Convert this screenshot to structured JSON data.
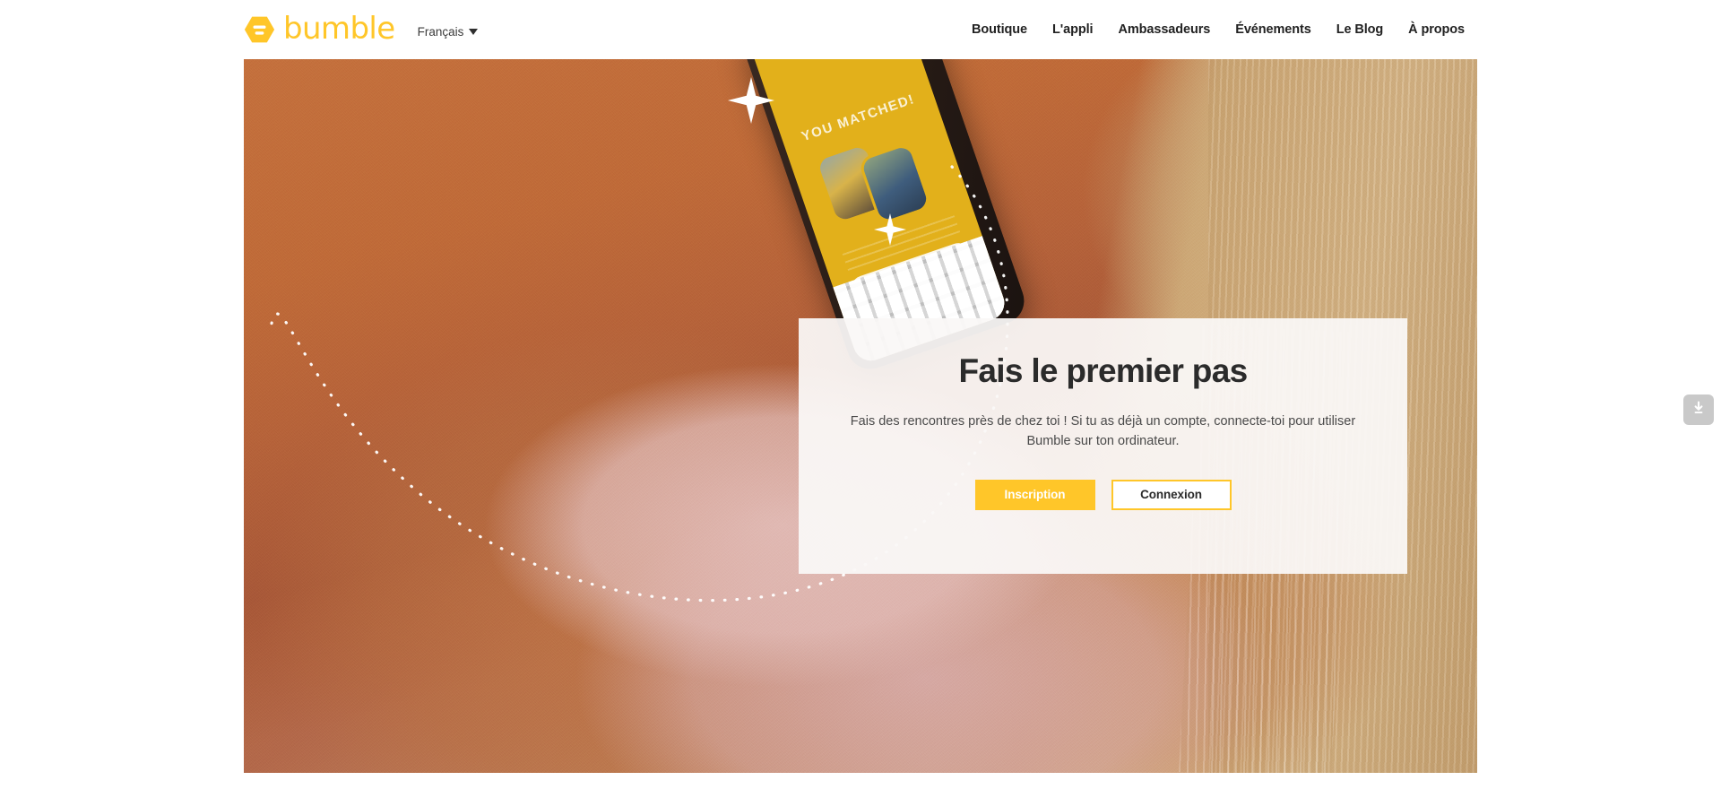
{
  "header": {
    "brand_name": "bumble",
    "brand_color": "#FFC629",
    "language": {
      "label": "Français",
      "icon": "chevron-down-icon"
    },
    "nav_items": [
      {
        "label": "Boutique"
      },
      {
        "label": "L'appli"
      },
      {
        "label": "Ambassadeurs"
      },
      {
        "label": "Événements"
      },
      {
        "label": "Le Blog"
      },
      {
        "label": "À propos"
      }
    ]
  },
  "hero": {
    "phone_screen": {
      "matched_label": "YOU MATCHED!"
    },
    "card": {
      "title": "Fais le premier pas",
      "subtitle": "Fais des rencontres près de chez toi ! Si tu as déjà un compte, connecte-toi pour utiliser Bumble sur ton ordinateur.",
      "primary_button": "Inscription",
      "secondary_button": "Connexion",
      "primary_button_color": "#FFC629",
      "secondary_button_border_color": "#FFC629",
      "title_color": "#2b2b2b"
    }
  },
  "side_tab": {
    "icon": "download-icon"
  }
}
